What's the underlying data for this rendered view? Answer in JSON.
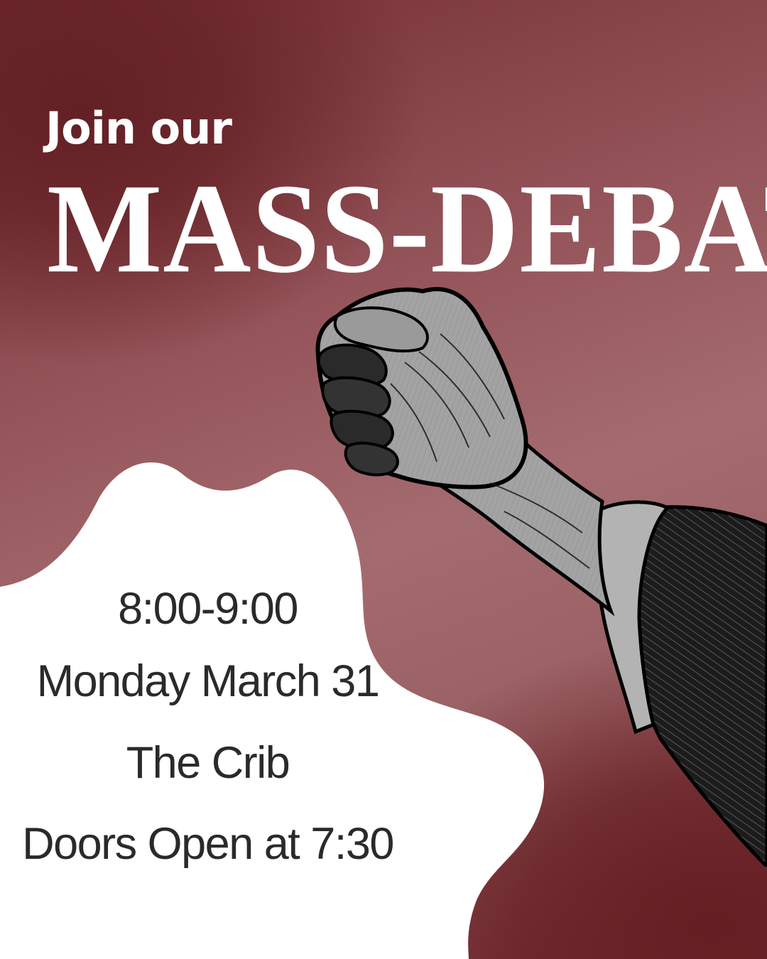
{
  "headline": {
    "intro": "Join our",
    "title": "MASS-DEBATE"
  },
  "event": {
    "time": "8:00-9:00",
    "date": "Monday March 31",
    "venue": "The Crib",
    "doors": "Doors Open at 7:30"
  },
  "colors": {
    "background_dark": "#5e1e22",
    "background_light": "#a0686c",
    "blob": "#ffffff",
    "headline_text": "#ffffff",
    "info_text": "#2a2a2a",
    "fist_skin": "#a3a3a3",
    "sleeve": "#1e1e1e"
  },
  "illustration": {
    "subject": "raised-fist-icon"
  }
}
